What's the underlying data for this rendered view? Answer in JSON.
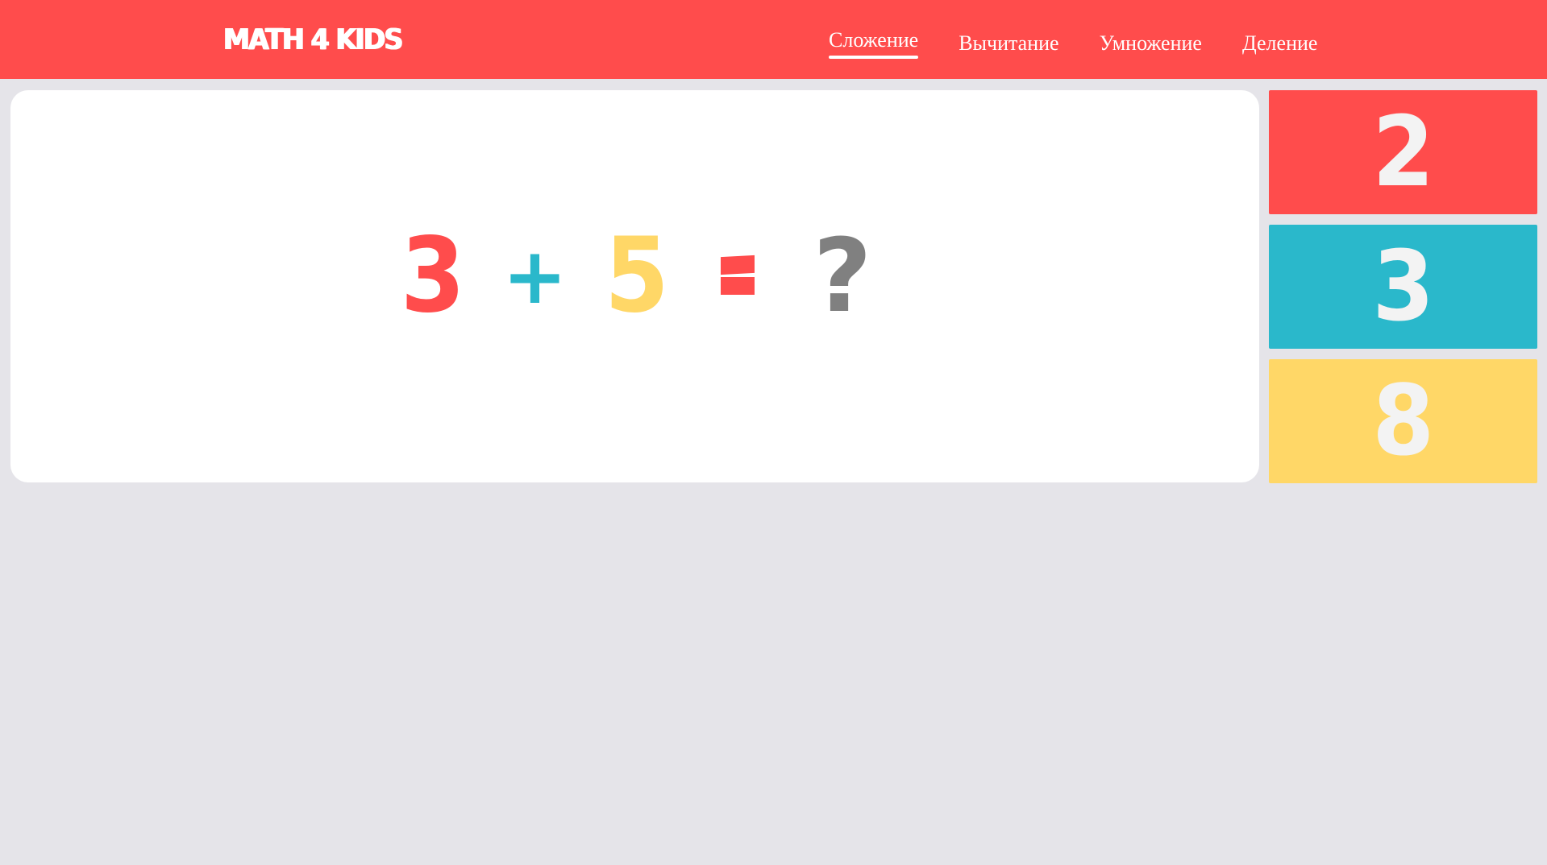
{
  "header": {
    "logo": "MATH 4 KIDS",
    "nav": [
      {
        "label": "Сложение",
        "active": true
      },
      {
        "label": "Вычитание",
        "active": false
      },
      {
        "label": "Умножение",
        "active": false
      },
      {
        "label": "Деление",
        "active": false
      }
    ]
  },
  "problem": {
    "operand1": "3",
    "operator": "+",
    "operand2": "5",
    "equals": "=",
    "unknown": "?"
  },
  "answers": [
    {
      "value": "2",
      "color": "#ff4c4c"
    },
    {
      "value": "3",
      "color": "#2ab8cb"
    },
    {
      "value": "8",
      "color": "#ffd767"
    }
  ],
  "colors": {
    "header_bg": "#ff4c4c",
    "page_bg": "#e5e4e9",
    "card_bg": "#ffffff",
    "red": "#ff4c4c",
    "teal": "#2ab8cb",
    "yellow": "#ffd767",
    "gray": "#808080"
  }
}
